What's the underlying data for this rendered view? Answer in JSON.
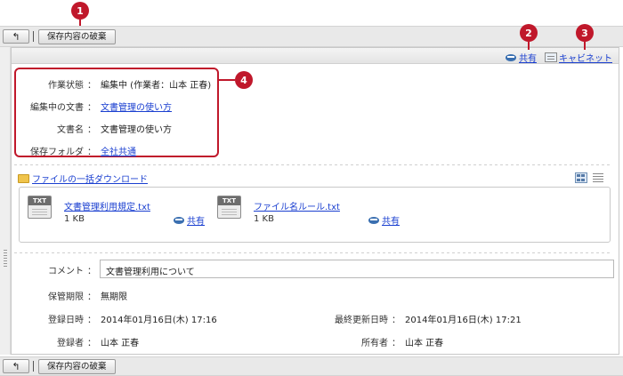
{
  "toolbar": {
    "discard_label": "保存内容の破棄",
    "back_glyph": "↰"
  },
  "header_links": {
    "share_label": "共有",
    "cabinet_label": "キャビネット"
  },
  "callouts": [
    "1",
    "2",
    "3",
    "4"
  ],
  "info": {
    "status_label": "作業状態",
    "status_value": "編集中 (作業者：山本 正春)",
    "editing_doc_label": "編集中の文書",
    "editing_doc_value": "文書管理の使い方",
    "doc_name_label": "文書名",
    "doc_name_value": "文書管理の使い方",
    "folder_label": "保存フォルダ",
    "folder_value": "全社共通",
    "colon": "："
  },
  "download": {
    "label": "ファイルの一括ダウンロード"
  },
  "files": [
    {
      "type": "TXT",
      "name": "文書管理利用規定.txt",
      "size": "1 KB",
      "share": "共有"
    },
    {
      "type": "TXT",
      "name": "ファイル名ルール.txt",
      "size": "1 KB",
      "share": "共有"
    }
  ],
  "details": {
    "comment_label": "コメント",
    "comment_value": "文書管理利用について",
    "retention_label": "保管期限",
    "retention_value": "無期限",
    "registered_label": "登録日時",
    "registered_value": "2014年01月16日(木) 17:16",
    "updated_label": "最終更新日時",
    "updated_value": "2014年01月16日(木) 17:21",
    "registrant_label": "登録者",
    "registrant_value": "山本 正春",
    "owner_label": "所有者",
    "owner_value": "山本 正春",
    "colon": "："
  },
  "colors": {
    "accent_red": "#c0182b",
    "link_blue": "#1a3fd0"
  }
}
